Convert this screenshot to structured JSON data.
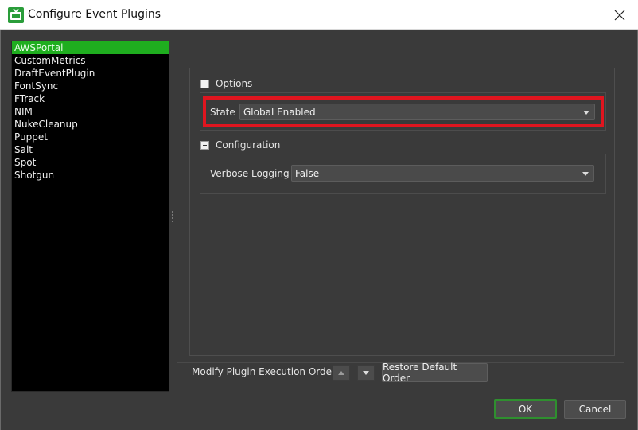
{
  "window": {
    "title": "Configure Event Plugins",
    "icon": "tv-app-icon",
    "close_icon": "close-icon"
  },
  "plugins": [
    "AWSPortal",
    "CustomMetrics",
    "DraftEventPlugin",
    "FontSync",
    "FTrack",
    "NIM",
    "NukeCleanup",
    "Puppet",
    "Salt",
    "Spot",
    "Shotgun"
  ],
  "selected_plugin": "AWSPortal",
  "options_group": {
    "label": "Options",
    "state_label": "State",
    "state_value": "Global Enabled"
  },
  "configuration_group": {
    "label": "Configuration",
    "verbose_label": "Verbose Logging",
    "verbose_value": "False"
  },
  "bottom": {
    "order_label": "Modify Plugin Execution Order",
    "move_up_icon": "arrow-up-icon",
    "move_down_icon": "arrow-down-icon",
    "restore_label": "Restore Default Order",
    "ok_label": "OK",
    "cancel_label": "Cancel"
  },
  "colors": {
    "selection": "#1fae1f",
    "highlight_border": "#e0151f",
    "background": "#3a3a3a"
  }
}
